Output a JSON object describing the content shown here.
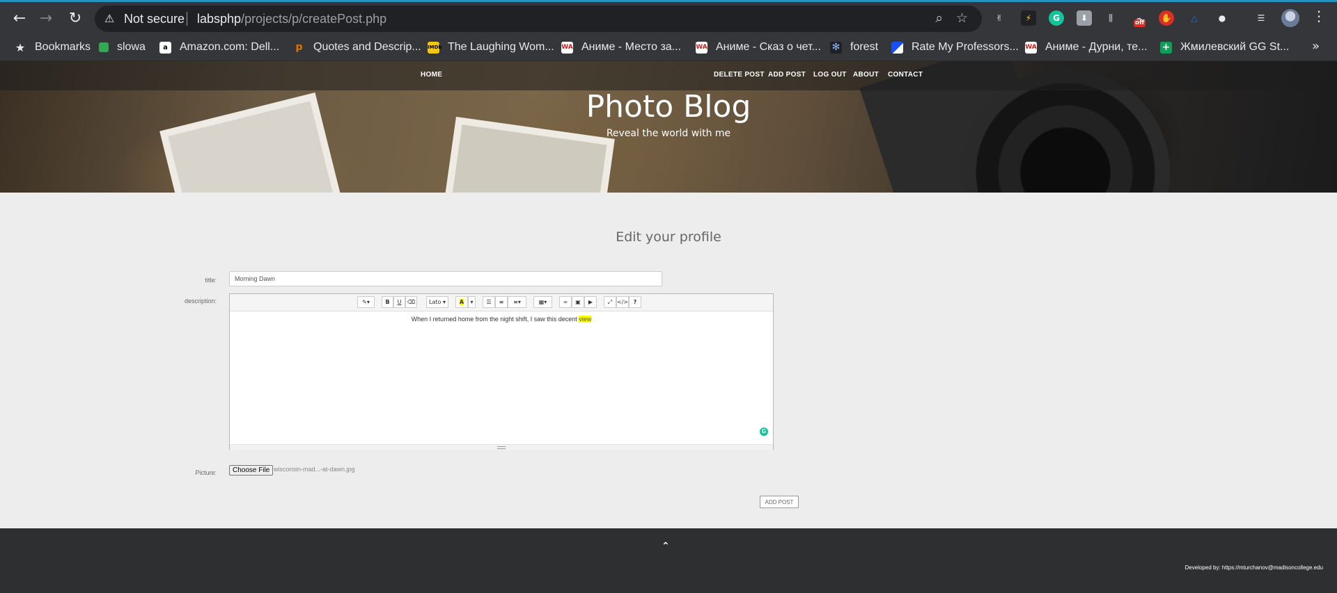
{
  "browser": {
    "security_label": "Not secure",
    "url_host": "labsphp",
    "url_path": "/projects/p/createPost.php",
    "bookmarks": [
      {
        "label": "Bookmarks",
        "icon": "star-icon",
        "color": "#e8eaed"
      },
      {
        "label": "slowa",
        "icon": "green-square-icon",
        "color": "#34a853"
      },
      {
        "label": "Amazon.com: Dell...",
        "icon": "amazon-icon",
        "color": "#ffffff"
      },
      {
        "label": "Quotes and Descrip...",
        "icon": "quotes-icon",
        "color": "#e37400"
      },
      {
        "label": "The Laughing Wom...",
        "icon": "imdb-icon",
        "color": "#f5c518"
      },
      {
        "label": "Аниме - Место за...",
        "icon": "wa-icon",
        "color": "#c5221f"
      },
      {
        "label": "Аниме - Сказ о чет...",
        "icon": "wa-icon",
        "color": "#c5221f"
      },
      {
        "label": "forest",
        "icon": "snowflake-icon",
        "color": "#4285f4"
      },
      {
        "label": "Rate My Professors...",
        "icon": "rmp-icon",
        "color": "#1a4ff5"
      },
      {
        "label": "Аниме - Дурни, те...",
        "icon": "wa-icon",
        "color": "#c5221f"
      },
      {
        "label": "Жмилевский GG St...",
        "icon": "cross-icon",
        "color": "#0f9d58"
      }
    ],
    "ext_badge": "off"
  },
  "site": {
    "nav_left": "HOME",
    "nav_right": [
      "DELETE POST",
      "ADD POST",
      "LOG OUT",
      "ABOUT",
      "CONTACT"
    ],
    "title": "Photo Blog",
    "subtitle": "Reveal the world with me"
  },
  "form": {
    "heading": "Edit your profile",
    "title_label": "title:",
    "title_value": "Morning Dawn",
    "description_label": "description:",
    "toolbar": {
      "font_name": "Lato",
      "bold": "B",
      "underline": "U",
      "highlight": "A",
      "help": "?",
      "code": "</>"
    },
    "description_text": "When I returned home from the night shift, I saw this decent ",
    "description_highlight": "view",
    "picture_label": "Picture:",
    "choose_file": "Choose File",
    "file_name": "wisconsin-mad...-at-dawn.jpg",
    "submit": "ADD POST"
  },
  "footer": {
    "scroll_top": "⌃",
    "credit": "Developed by: https://mturchanov@madisoncollege.edu"
  }
}
